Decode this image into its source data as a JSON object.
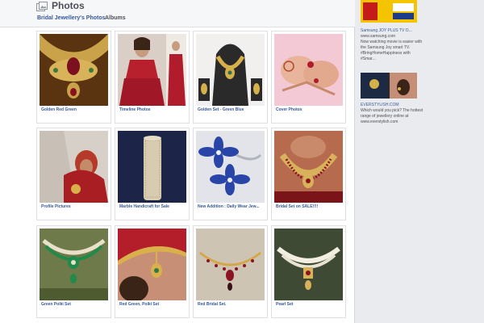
{
  "header": {
    "title": "Photos",
    "tabs": [
      {
        "label": "Bridal Jewellery's Photos"
      },
      {
        "label": "Albums"
      }
    ]
  },
  "albums": [
    {
      "caption": "Golden Red Green"
    },
    {
      "caption": "Timeline Photos"
    },
    {
      "caption": "Golden Set - Green Blue"
    },
    {
      "caption": "Cover Photos"
    },
    {
      "caption": "Profile Pictures"
    },
    {
      "caption": "Marble Handicraft for Sale"
    },
    {
      "caption": "New Addition : Daily Wear Jew..."
    },
    {
      "caption": "Bridal Set on SALE!!!!"
    },
    {
      "caption": "Green Polki Set"
    },
    {
      "caption": "Red Green, Polki Set"
    },
    {
      "caption": "Red Bridal Set."
    },
    {
      "caption": "Pearl Set"
    }
  ],
  "sidebar": {
    "ad1": {
      "title": "Samsung JOY PLUS TV O...",
      "url": "www.samsung.com",
      "text": "Now watching movie is easier with the Samsung Joy smart TV. #BringHomeHappiness with #Smar..."
    },
    "ad2": {
      "title": "EVERSTYLISH.COM",
      "text": "Which would you pick? The hottest range of jewellery online at www.everstylish.com"
    }
  },
  "colors": {
    "link": "#365899",
    "background": "#e9ebee"
  }
}
